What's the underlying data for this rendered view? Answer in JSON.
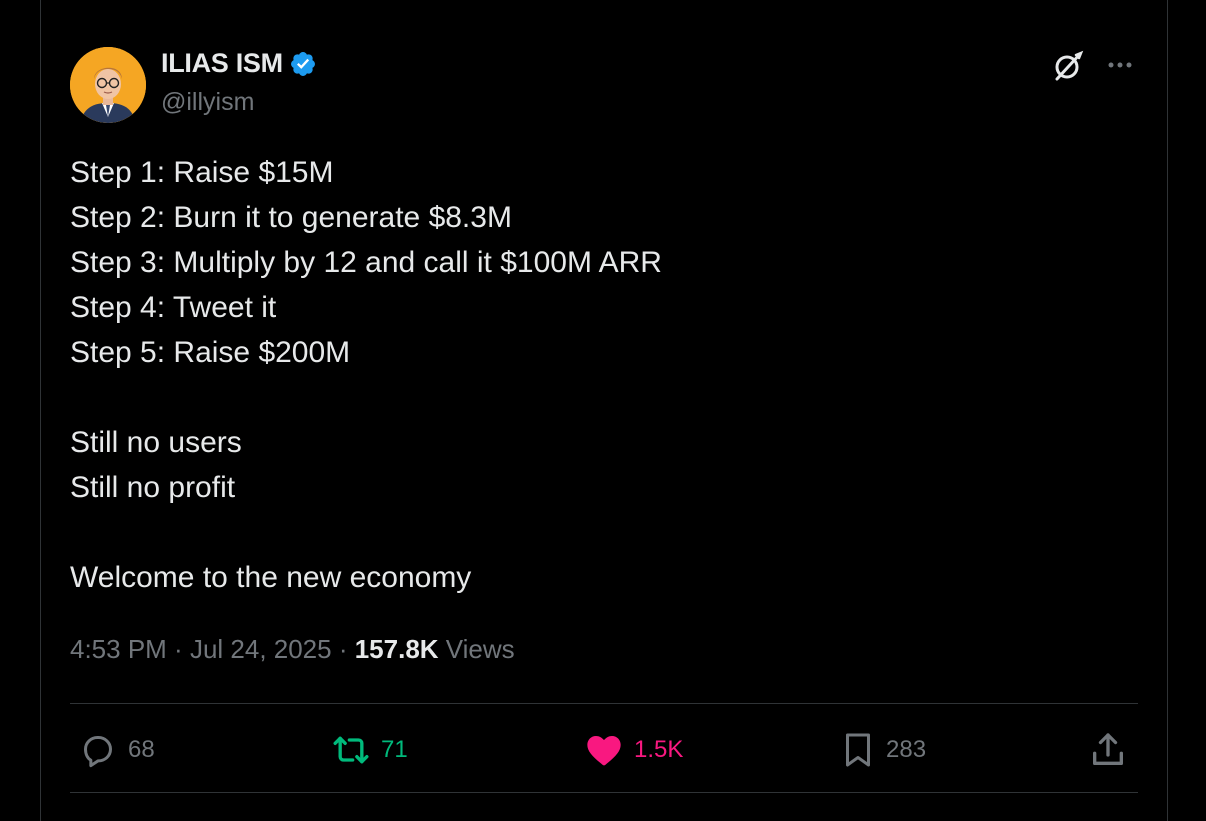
{
  "author": {
    "name": "ILIAS ISM",
    "handle": "@illyism",
    "verified": true,
    "verified_color": "#1d9bf0",
    "avatar_bg": "#f5a623"
  },
  "header_icons": {
    "grok": "grok-icon",
    "more": "more-icon"
  },
  "tweet": {
    "lines": [
      "Step 1: Raise $15M",
      "Step 2: Burn it to generate $8.3M",
      "Step 3: Multiply by 12 and call it $100M ARR",
      "Step 4: Tweet it",
      "Step 5: Raise $200M",
      "",
      "Still no users",
      "Still no profit",
      "",
      "Welcome to the new economy"
    ]
  },
  "meta": {
    "time": "4:53 PM",
    "separator": " · ",
    "date": "Jul 24, 2025",
    "views_count": "157.8K",
    "views_label": " Views"
  },
  "actions": {
    "reply": {
      "count": "68",
      "icon": "reply-icon",
      "color": "#71767b"
    },
    "retweet": {
      "count": "71",
      "icon": "retweet-icon",
      "color": "#00ba7c"
    },
    "like": {
      "count": "1.5K",
      "icon": "heart-icon",
      "color": "#f91880"
    },
    "bookmark": {
      "count": "283",
      "icon": "bookmark-icon",
      "color": "#71767b"
    },
    "share": {
      "icon": "share-icon",
      "color": "#71767b"
    }
  }
}
